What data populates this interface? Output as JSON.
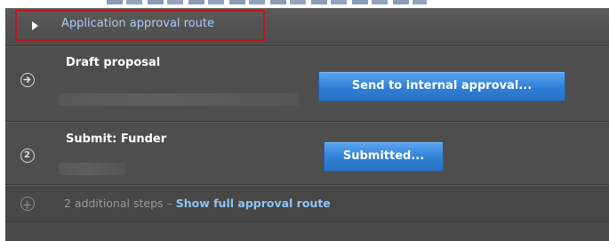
{
  "approval_route": {
    "header_title": "Application approval route",
    "steps": [
      {
        "number": "",
        "icon": "arrow-right-circle-icon",
        "title": "Draft proposal",
        "action_label": "Send to internal approval..."
      },
      {
        "number": "2",
        "icon": "numbered-circle-icon",
        "title": "Submit: Funder",
        "action_label": "Submitted..."
      }
    ],
    "additional": {
      "icon": "plus-circle-icon",
      "text": "2 additional steps – ",
      "link_label": "Show full approval route"
    }
  },
  "colors": {
    "panel_background": "#4d4d4d",
    "highlight_border": "#c0141b",
    "header_title": "#a9cdf0",
    "button_blue": "#2f7fd6",
    "link_blue": "#8fc4f2"
  }
}
